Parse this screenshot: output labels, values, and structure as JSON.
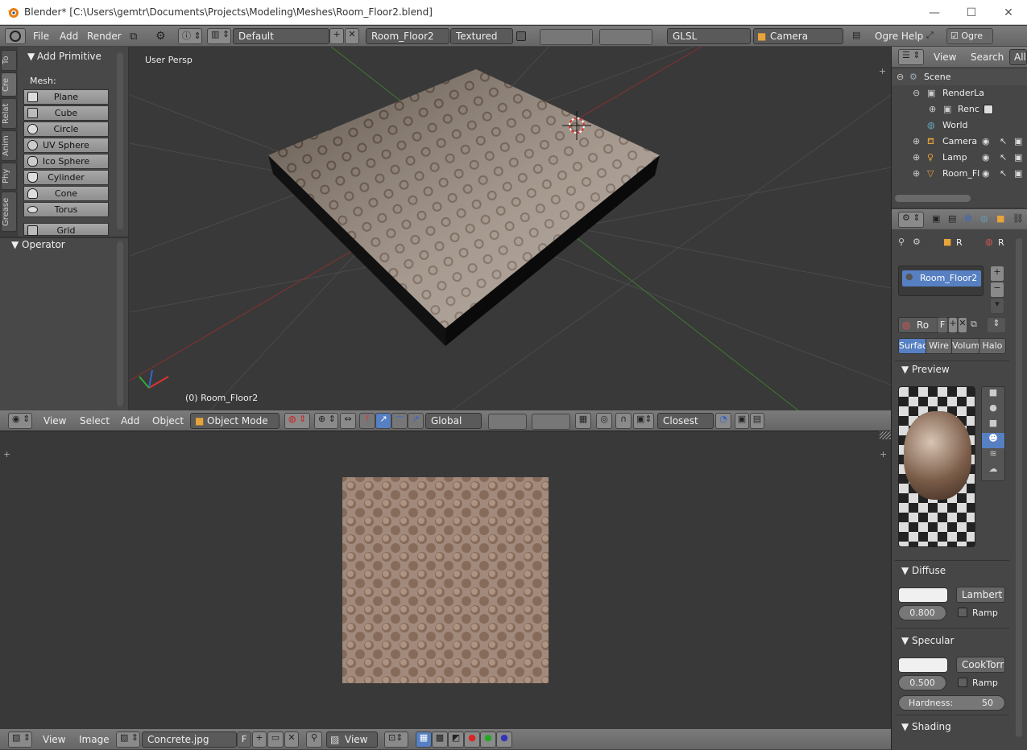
{
  "window": {
    "title": "Blender* [C:\\Users\\gemtr\\Documents\\Projects\\Modeling\\Meshes\\Room_Floor2.blend]",
    "minimize": "—",
    "maximize": "☐",
    "close": "✕"
  },
  "info_header": {
    "menus": [
      "File",
      "Add",
      "Render"
    ],
    "screen_layout": "Default",
    "scene": "Room_Floor2",
    "viewport_shade": "Textured",
    "render_engine": "GLSL",
    "camera": "Camera",
    "help": "Ogre Help",
    "ogre_label": "Ogre"
  },
  "toolshelf": {
    "tabs": [
      "To",
      "Cre",
      "Relat",
      "Anim",
      "Phy",
      "Grease"
    ],
    "panel_title": "Add Primitive",
    "mesh_label": "Mesh:",
    "primitives": [
      "Plane",
      "Cube",
      "Circle",
      "UV Sphere",
      "Ico Sphere",
      "Cylinder",
      "Cone",
      "Torus",
      "Grid"
    ],
    "operator_title": "Operator"
  },
  "viewport": {
    "view_label": "User Persp",
    "object_label": "(0) Room_Floor2"
  },
  "viewport_header": {
    "menus": [
      "View",
      "Select",
      "Add",
      "Object"
    ],
    "mode": "Object Mode",
    "orientation": "Global",
    "snap": "Closest"
  },
  "image_editor_header": {
    "menus": [
      "View",
      "Image"
    ],
    "image_name": "Concrete.jpg",
    "fake_user": "F",
    "view_mode": "View"
  },
  "outliner": {
    "menus": [
      "View",
      "Search",
      "All"
    ],
    "items": [
      "Scene",
      "RenderLa",
      "Renc",
      "World",
      "Camera",
      "Lamp",
      "Room_Fl"
    ]
  },
  "properties": {
    "breadcrumb": [
      "R",
      "R"
    ],
    "material_slot": "Room_Floor2",
    "material_name": "Ro",
    "fake_user": "F",
    "type_tabs": [
      "Surfac",
      "Wire",
      "Volum",
      "Halo"
    ],
    "sections": {
      "preview": "Preview",
      "diffuse": "Diffuse",
      "specular": "Specular",
      "shading": "Shading"
    },
    "diffuse": {
      "shader": "Lambert",
      "intensity": "0.800",
      "ramp": "Ramp"
    },
    "specular": {
      "shader": "CookTorr",
      "intensity": "0.500",
      "ramp": "Ramp",
      "hardness_label": "Hardness:",
      "hardness": "50"
    }
  },
  "colors": {
    "selected": "#5680c2",
    "header": "#727272",
    "panel": "#464646",
    "viewport": "#393939"
  }
}
